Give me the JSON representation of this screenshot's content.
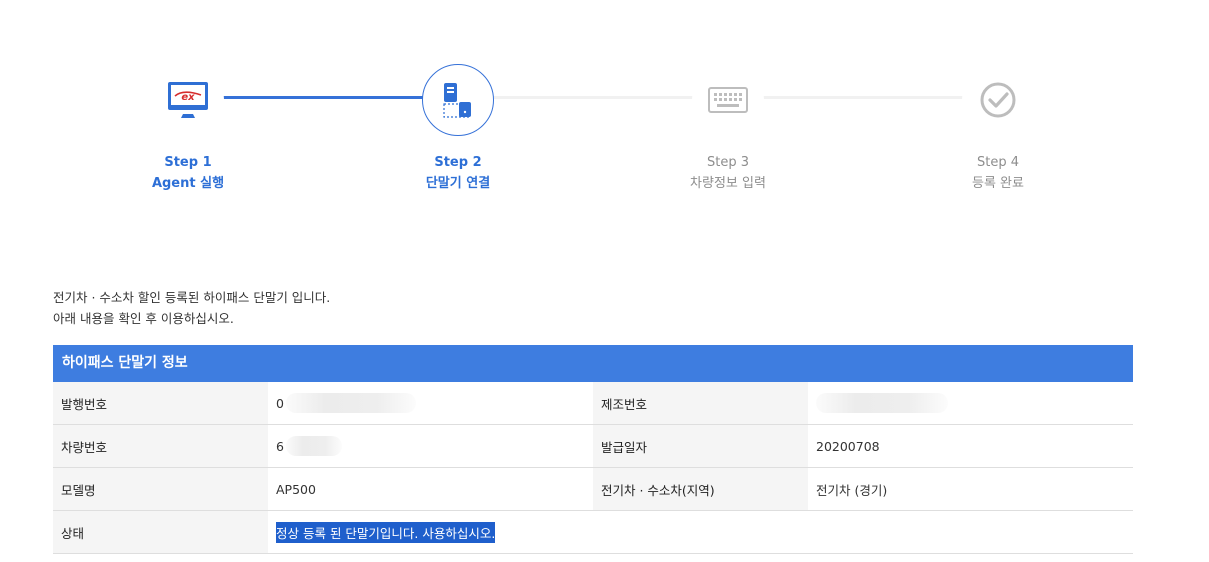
{
  "steps": [
    {
      "num": "Step 1",
      "label": "Agent 실행",
      "state": "active",
      "icon": "ex-monitor-icon"
    },
    {
      "num": "Step 2",
      "label": "단말기 연결",
      "state": "active",
      "icon": "device-link-icon"
    },
    {
      "num": "Step 3",
      "label": "차량정보 입력",
      "state": "pending",
      "icon": "keyboard-icon"
    },
    {
      "num": "Step 4",
      "label": "등록 완료",
      "state": "pending",
      "icon": "check-circle-icon"
    }
  ],
  "intro": {
    "line1": "전기차 · 수소차 할인 등록된 하이패스 단말기 입니다.",
    "line2": "아래 내용을 확인 후 이용하십시오."
  },
  "info": {
    "title": "하이패스 단말기 정보",
    "rows": [
      {
        "label1": "발행번호",
        "value1": "0",
        "label2": "제조번호",
        "value2": ""
      },
      {
        "label1": "차량번호",
        "value1": "6",
        "label2": "발급일자",
        "value2": "20200708"
      },
      {
        "label1": "모델명",
        "value1": "AP500",
        "label2": "전기차 · 수소차(지역)",
        "value2": "전기차 (경기)"
      }
    ],
    "status_label": "상태",
    "status_value": "정상 등록 된 단말기입니다. 사용하십시오."
  },
  "colors": {
    "accent": "#3e7de0",
    "active_text": "#2d6fd6",
    "pending_text": "#8d8d8d"
  }
}
